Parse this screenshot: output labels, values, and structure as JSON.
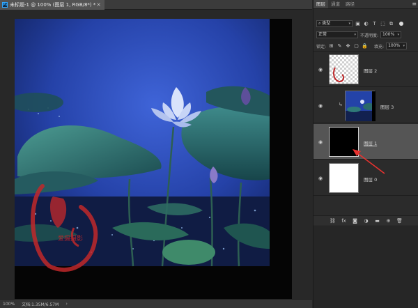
{
  "document": {
    "tab_title": "未标题-1 @ 100% (图层 1, RGB/8*) *",
    "close_glyph": "×",
    "app_icon_text": "Ps"
  },
  "status": {
    "zoom": "100%",
    "doc_info": "文档:1.35M/6.57M",
    "arrow_glyph": "›"
  },
  "panel": {
    "tabs": [
      {
        "label": "图层",
        "active": true
      },
      {
        "label": "通道",
        "active": false
      },
      {
        "label": "路径",
        "active": false
      }
    ],
    "menu_glyph": "≡",
    "filter": {
      "kind_label": "类型",
      "icons": [
        "image-filter-icon",
        "adjustment-filter-icon",
        "type-filter-icon",
        "shape-filter-icon",
        "smart-object-filter-icon"
      ]
    },
    "blend": {
      "mode": "正常",
      "opacity_label": "不透明度:",
      "opacity_value": "100%"
    },
    "lock": {
      "lock_label": "锁定:",
      "fill_label": "填充:",
      "fill_value": "100%"
    },
    "layers": [
      {
        "name": "图层 2",
        "thumb": "transparent",
        "selected": false
      },
      {
        "name": "图层 3",
        "thumb": "photo",
        "selected": false,
        "clipped": true
      },
      {
        "name": "图层 1",
        "thumb": "black",
        "selected": true
      },
      {
        "name": "图层 0",
        "thumb": "white",
        "selected": false
      }
    ],
    "footer_icons": [
      "link-layers-icon",
      "fx-icon",
      "add-mask-icon",
      "adjustment-layer-icon",
      "new-group-icon",
      "new-layer-icon",
      "delete-layer-icon"
    ]
  },
  "watermark": {
    "text": "爱摄摄影"
  },
  "colors": {
    "annotation_arrow": "#e8322f",
    "selected_layer": "#555555",
    "accent": "#31a8ff"
  }
}
